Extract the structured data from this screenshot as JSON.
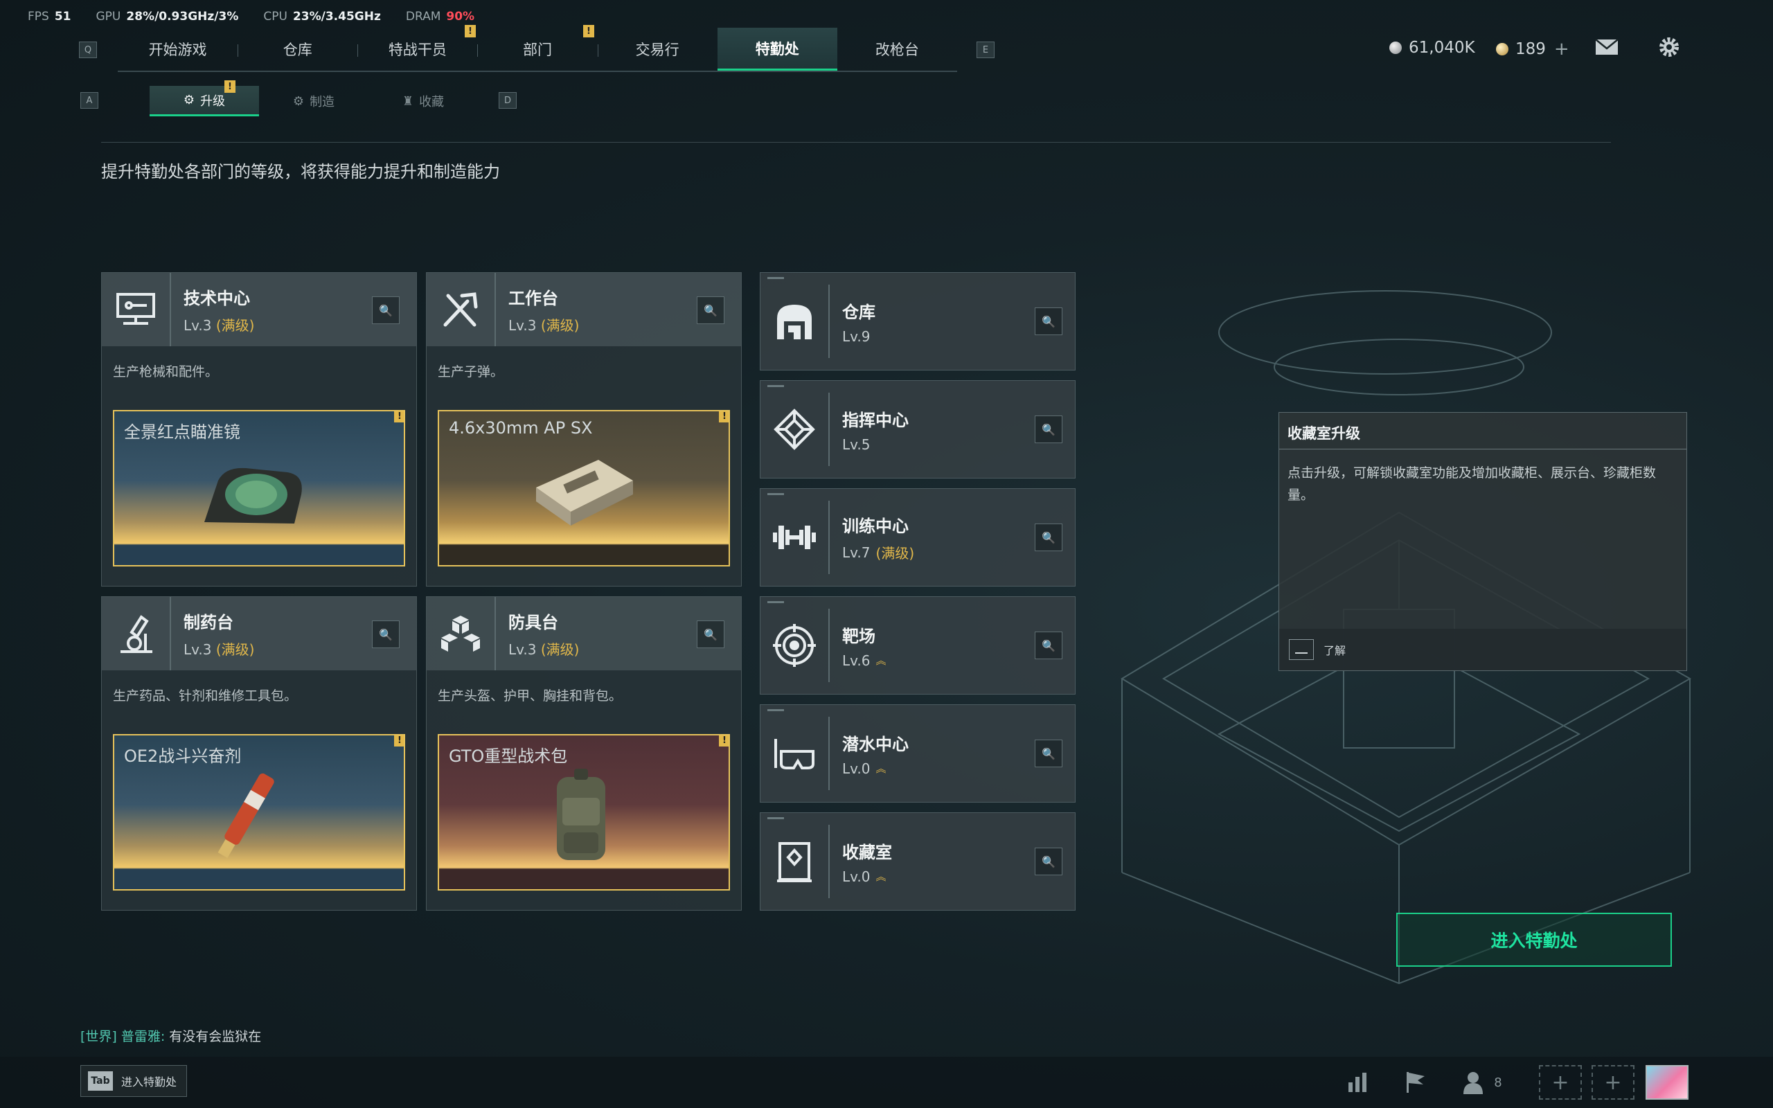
{
  "perf": {
    "fps_label": "FPS",
    "fps": "51",
    "gpu_label": "GPU",
    "gpu": "28%/0.93GHz/3%",
    "cpu_label": "CPU",
    "cpu": "23%/3.45GHz",
    "dram_label": "DRAM",
    "dram": "90%"
  },
  "nav": {
    "key_left": "Q",
    "key_right": "E",
    "tabs": [
      "开始游戏",
      "仓库",
      "特战干员",
      "部门",
      "交易行",
      "特勤处",
      "改枪台"
    ],
    "active_index": 5
  },
  "currency": {
    "silver": "61,040K",
    "gold": "189"
  },
  "subnav": {
    "key_left": "A",
    "key_right": "D",
    "tabs": [
      "升级",
      "制造",
      "收藏"
    ],
    "active_index": 0
  },
  "description": "提升特勤处各部门的等级，将获得能力提升和制造能力",
  "big_cards": [
    {
      "title": "技术中心",
      "level": "Lv.3",
      "max": "(满级)",
      "desc": "生产枪械和配件。",
      "item": "全景红点瞄准镜",
      "icon": "circuit-icon"
    },
    {
      "title": "工作台",
      "level": "Lv.3",
      "max": "(满级)",
      "desc": "生产子弹。",
      "item": "4.6x30mm AP SX",
      "icon": "tools-icon"
    },
    {
      "title": "制药台",
      "level": "Lv.3",
      "max": "(满级)",
      "desc": "生产药品、针剂和维修工具包。",
      "item": "OE2战斗兴奋剂",
      "icon": "microscope-icon"
    },
    {
      "title": "防具台",
      "level": "Lv.3",
      "max": "(满级)",
      "desc": "生产头盔、护甲、胸挂和背包。",
      "item": "GTO重型战术包",
      "icon": "cubes-icon"
    }
  ],
  "small_cards": [
    {
      "title": "仓库",
      "level": "Lv.9",
      "max": "",
      "upgrade": false,
      "icon": "warehouse-icon"
    },
    {
      "title": "指挥中心",
      "level": "Lv.5",
      "max": "",
      "upgrade": false,
      "icon": "command-icon"
    },
    {
      "title": "训练中心",
      "level": "Lv.7",
      "max": "(满级)",
      "upgrade": false,
      "icon": "dumbbell-icon"
    },
    {
      "title": "靶场",
      "level": "Lv.6",
      "max": "",
      "upgrade": true,
      "icon": "target-icon"
    },
    {
      "title": "潜水中心",
      "level": "Lv.0",
      "max": "",
      "upgrade": true,
      "icon": "diving-icon"
    },
    {
      "title": "收藏室",
      "level": "Lv.0",
      "max": "",
      "upgrade": true,
      "icon": "collection-icon"
    }
  ],
  "tooltip": {
    "title": "收藏室升级",
    "body": "点击升级，可解锁收藏室功能及增加收藏柜、展示台、珍藏柜数量。",
    "action": "了解"
  },
  "enter_button": "进入特勤处",
  "chat": {
    "channel": "[世界]",
    "sender": "普雷雅:",
    "message": "有没有会监狱在"
  },
  "bottom": {
    "tab_key": "Tab",
    "tab_label": "进入特勤处",
    "friends_count": "8"
  },
  "colors": {
    "accent": "#1ad18a",
    "gold": "#e2b84a",
    "warning": "#e2b84a",
    "dram_red": "#ff4d5a"
  }
}
